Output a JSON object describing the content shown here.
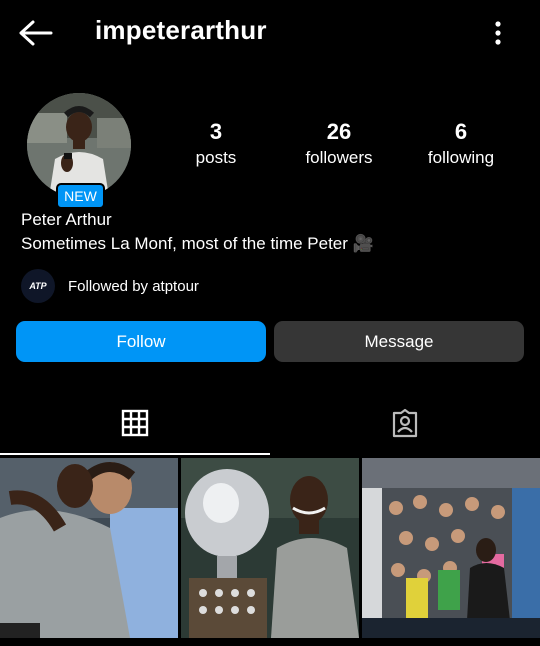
{
  "header": {
    "username": "impeterarthur"
  },
  "profile": {
    "badge": "NEW",
    "name": "Peter Arthur",
    "bio": "Sometimes La Monf, most of the time Peter 🎥",
    "followed_by": "Followed by atptour",
    "followed_by_avatar_text": "ATP"
  },
  "stats": [
    {
      "value": "3",
      "label": "posts"
    },
    {
      "value": "26",
      "label": "followers"
    },
    {
      "value": "6",
      "label": "following"
    }
  ],
  "actions": {
    "follow_label": "Follow",
    "message_label": "Message"
  },
  "tabs": [
    {
      "icon": "grid-icon",
      "active": true
    },
    {
      "icon": "tagged-icon",
      "active": false
    }
  ],
  "posts": [
    {
      "subject": "players-hugging"
    },
    {
      "subject": "player-with-trophy"
    },
    {
      "subject": "crowd-and-player"
    }
  ],
  "colors": {
    "accent": "#0095f6",
    "secondary_button": "#363636",
    "background": "#000000"
  }
}
